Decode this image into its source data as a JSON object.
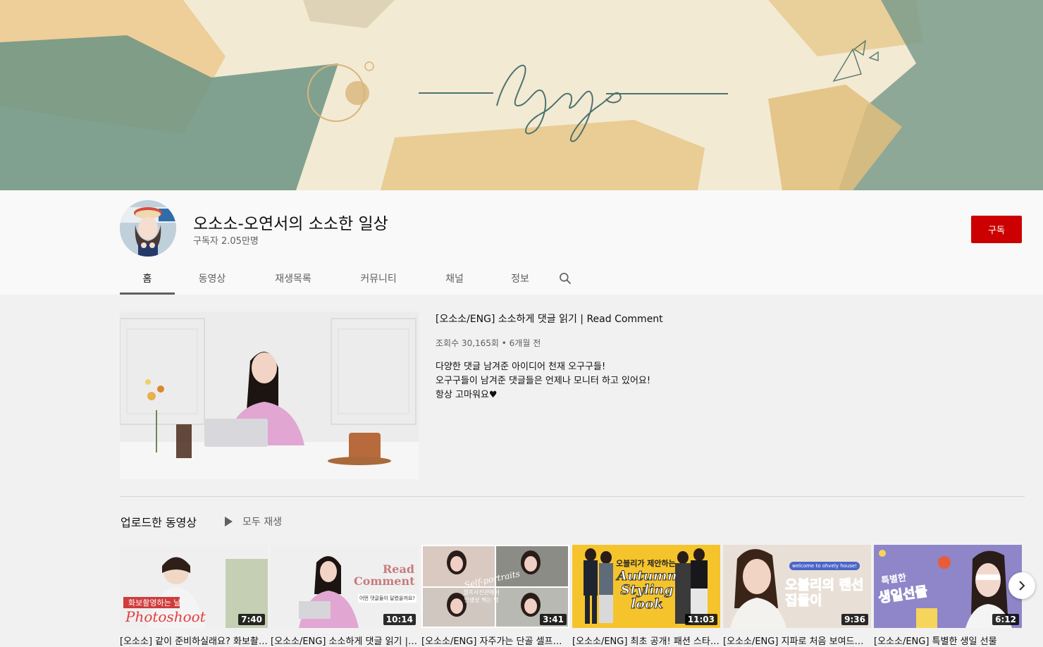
{
  "banner": {
    "signature": "ohyeye"
  },
  "channel": {
    "name": "오소소-오연서의 소소한 일상",
    "subscribers": "구독자 2.05만명",
    "subscribe_label": "구독"
  },
  "tabs": [
    {
      "label": "홈"
    },
    {
      "label": "동영상"
    },
    {
      "label": "재생목록"
    },
    {
      "label": "커뮤니티"
    },
    {
      "label": "채널"
    },
    {
      "label": "정보"
    }
  ],
  "featured": {
    "title": "[오소소/ENG] 소소하게 댓글 읽기 | Read Comment",
    "meta": "조회수 30,165회 • 6개월 전",
    "description": [
      "다양한 댓글 남겨준 아이디어 천재 오구구들!",
      "오구구들이 남겨준 댓글들은 언제나 모니터 하고 있어요!",
      "항상 고마워요♥"
    ]
  },
  "uploads": {
    "section_title": "업로드한 동영상",
    "play_all_label": "모두 재생",
    "videos": [
      {
        "title": "[오소소] 같이 준비하실래요? 화보촬영하는 날",
        "duration": "7:40",
        "thumb_caption": "화보촬영하는 날",
        "thumb_text": "Photoshoot"
      },
      {
        "title": "[오소소/ENG] 소소하게 댓글 읽기 | Read Comment",
        "duration": "10:14",
        "thumb_text": "Read Comment",
        "thumb_caption": "어떤 댓글들이 달렸을까요?"
      },
      {
        "title": "[오소소/ENG] 자주가는 단골 셀프사진관",
        "duration": "3:41",
        "thumb_text": "Self-portraits",
        "thumb_caption": "셀프사진관에서 인생샷 찍는 법"
      },
      {
        "title": "[오소소/ENG] 최초 공개! 패션 스타일링",
        "duration": "11:03",
        "thumb_caption": "오블리가 제안하는",
        "thumb_text": "Autumn Styling look"
      },
      {
        "title": "[오소소/ENG] 지파로 처음 보여드리는 집",
        "duration": "9:36",
        "thumb_caption": "welcome to ohvely house!",
        "thumb_text": "오블리의 랜선집들이"
      },
      {
        "title": "[오소소/ENG] 특별한 생일 선물",
        "duration": "6:12",
        "thumb_caption": "특별한",
        "thumb_text": "생일선물"
      }
    ]
  }
}
